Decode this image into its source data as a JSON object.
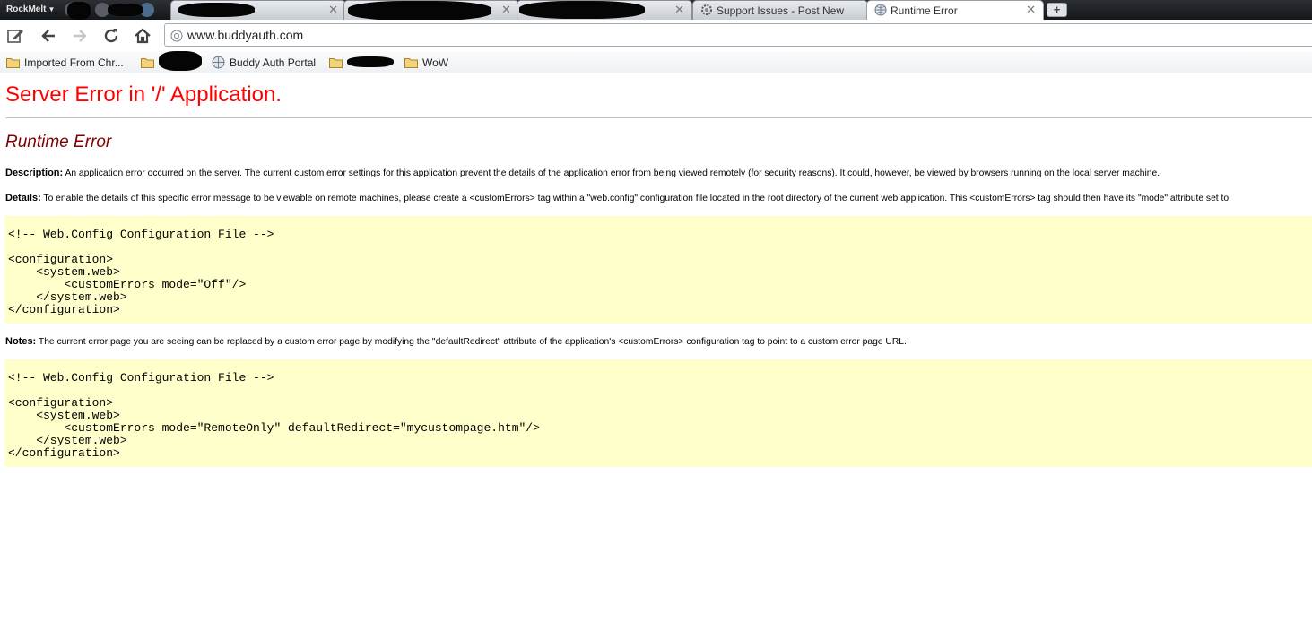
{
  "browser": {
    "brand": "RockMelt",
    "tabs": [
      {
        "title": "Support Issues - Post New T",
        "active": false
      },
      {
        "title": "Runtime Error",
        "active": true
      }
    ],
    "new_tab_label": "+",
    "address": "www.buddyauth.com",
    "bookmarks": [
      {
        "label": "Imported From Chr...",
        "icon": "folder-icon"
      },
      {
        "label": "Buddy Auth Portal",
        "icon": "globe-icon"
      },
      {
        "label": "WoW",
        "icon": "folder-icon"
      }
    ]
  },
  "page": {
    "title": "Server Error in '/' Application.",
    "subtitle": "Runtime Error",
    "description_label": "Description:",
    "description_text": " An application error occurred on the server. The current custom error settings for this application prevent the details of the application error from being viewed remotely (for security reasons). It could, however, be viewed by browsers running on the local server machine.",
    "details_label": "Details:",
    "details_text": " To enable the details of this specific error message to be viewable on remote machines, please create a <customErrors> tag within a \"web.config\" configuration file located in the root directory of the current web application. This <customErrors> tag should then have its \"mode\" attribute set to",
    "code1": "\n<!-- Web.Config Configuration File -->\n\n<configuration>\n    <system.web>\n        <customErrors mode=\"Off\"/>\n    </system.web>\n</configuration>",
    "notes_label": "Notes:",
    "notes_text": " The current error page you are seeing can be replaced by a custom error page by modifying the \"defaultRedirect\" attribute of the application's <customErrors> configuration tag to point to a custom error page URL.",
    "code2": "\n<!-- Web.Config Configuration File -->\n\n<configuration>\n    <system.web>\n        <customErrors mode=\"RemoteOnly\" defaultRedirect=\"mycustompage.htm\"/>\n    </system.web>\n</configuration>"
  },
  "colors": {
    "title": "#ff0000",
    "subtitle": "#800000",
    "code_background": "#ffffcc"
  }
}
